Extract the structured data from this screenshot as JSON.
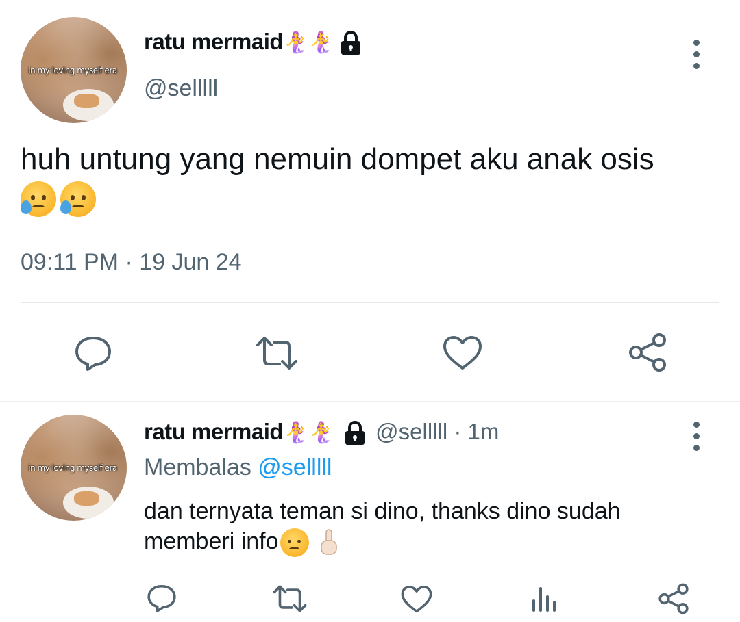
{
  "tweet": {
    "display_name": "ratu mermaid",
    "name_emoji": "🧜‍♀️🧜‍♀️",
    "handle": "@selllll",
    "avatar_caption": "in my loving myself era",
    "text": "huh untung yang nemuin dompet aku anak osis",
    "text_emoji": "😥😥",
    "timestamp": "09:11 PM · 19 Jun 24",
    "actions": [
      "reply-icon",
      "retweet-icon",
      "like-icon",
      "share-icon"
    ]
  },
  "reply": {
    "display_name": "ratu mermaid",
    "name_emoji": "🧜‍♀️🧜‍♀️",
    "handle_meta": "@selllll · 1m",
    "avatar_caption": "in my loving myself era",
    "replying_prefix": "Membalas",
    "replying_to": "@selllll",
    "text_line1": "dan ternyata teman si dino, thanks dino sudah",
    "text_line2": "memberi info",
    "text_emoji": "😞☝🏻",
    "actions": [
      "reply-icon",
      "retweet-icon",
      "like-icon",
      "analytics-icon",
      "share-icon"
    ]
  },
  "colors": {
    "text": "#0f1419",
    "muted": "#536471",
    "link": "#1d9bf0",
    "divider": "#e6e9eb"
  }
}
